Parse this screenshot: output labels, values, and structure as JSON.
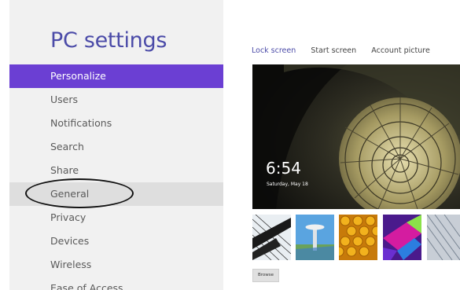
{
  "app": {
    "title": "PC settings"
  },
  "nav": {
    "items": [
      {
        "label": "Personalize",
        "state": "selected"
      },
      {
        "label": "Users",
        "state": ""
      },
      {
        "label": "Notifications",
        "state": ""
      },
      {
        "label": "Search",
        "state": ""
      },
      {
        "label": "Share",
        "state": ""
      },
      {
        "label": "General",
        "state": "hover"
      },
      {
        "label": "Privacy",
        "state": ""
      },
      {
        "label": "Devices",
        "state": ""
      },
      {
        "label": "Wireless",
        "state": ""
      },
      {
        "label": "Ease of Access",
        "state": ""
      }
    ]
  },
  "tabs": [
    {
      "label": "Lock screen",
      "active": true
    },
    {
      "label": "Start screen",
      "active": false
    },
    {
      "label": "Account picture",
      "active": false
    }
  ],
  "lock_preview": {
    "time": "6:54",
    "date": "Saturday, May 18"
  },
  "thumbnails": [
    "piano-keys-image",
    "space-needle-image",
    "honeycomb-image",
    "abstract-color-image",
    "tunnel-image"
  ],
  "browse_label": "Browse",
  "colors": {
    "accent": "#6b3fd3",
    "title": "#4b4ba8"
  }
}
